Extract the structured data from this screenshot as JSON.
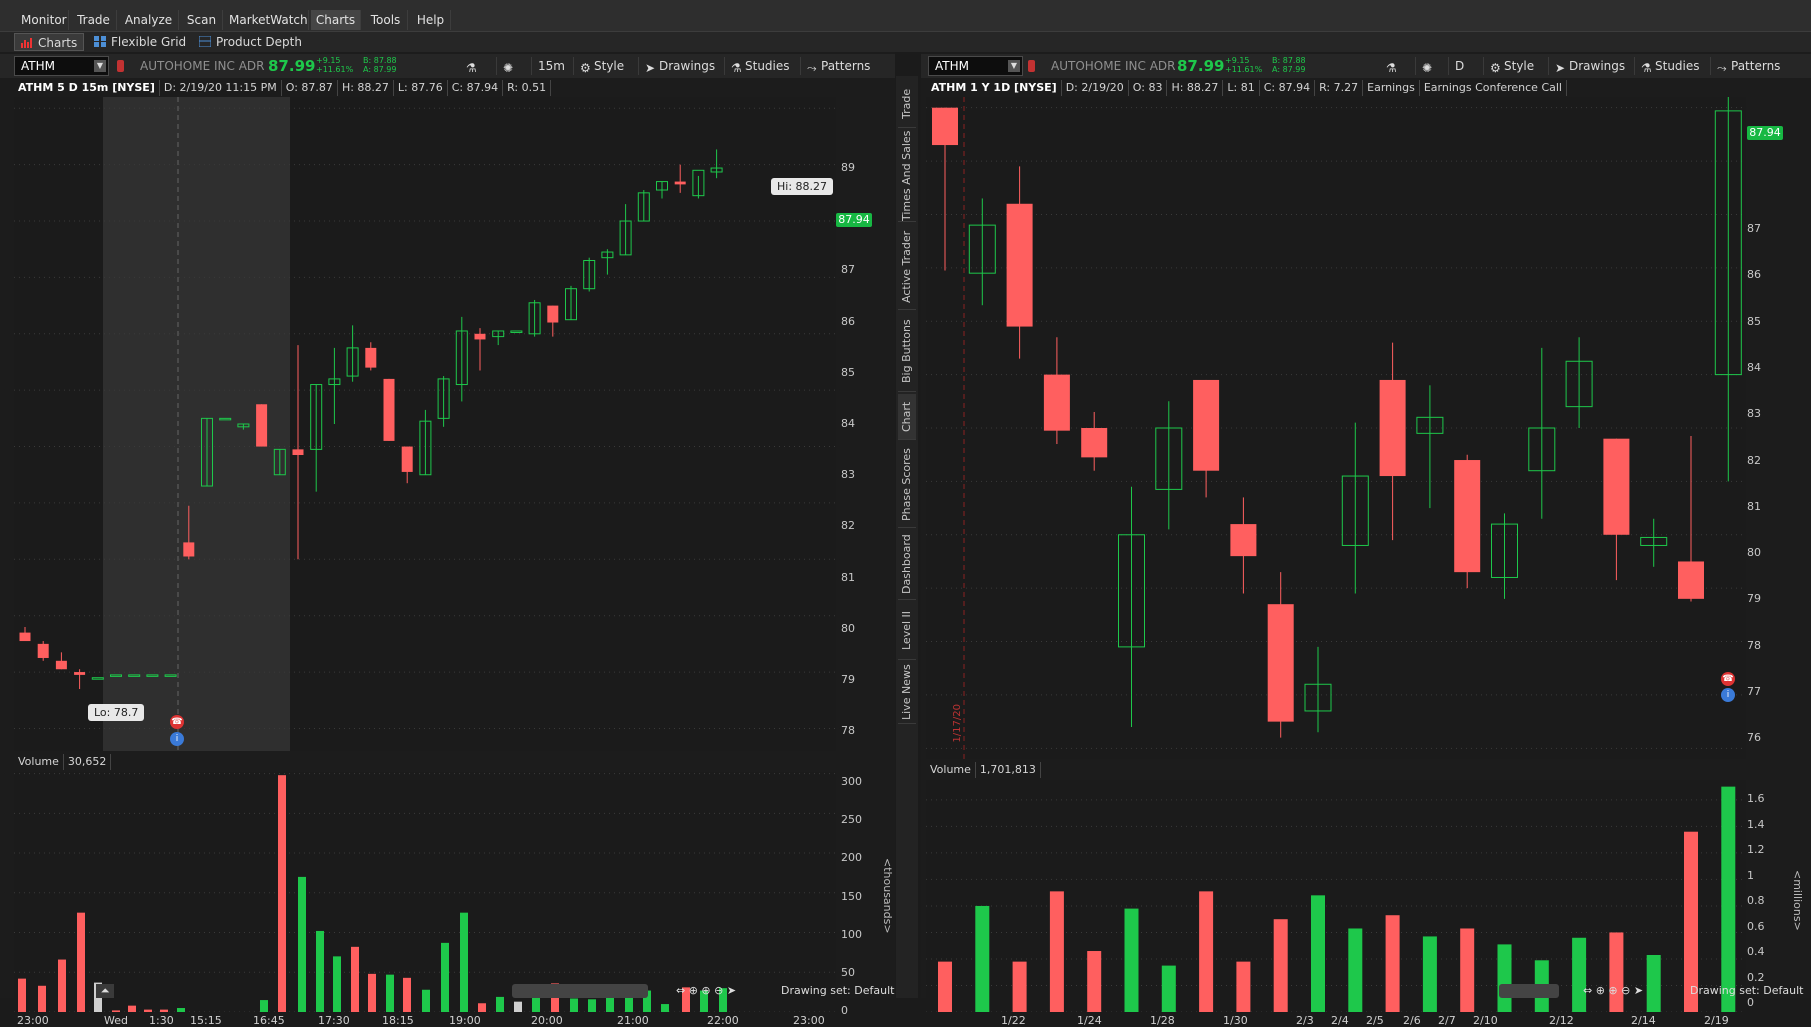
{
  "menu": [
    "Monitor",
    "Trade",
    "Analyze",
    "Scan",
    "MarketWatch",
    "Charts",
    "Tools",
    "Help"
  ],
  "submenu": {
    "charts": "Charts",
    "grid": "Flexible Grid",
    "depth": "Product Depth"
  },
  "left": {
    "symbol": "ATHM",
    "company": "AUTOHOME INC ADR",
    "last": "87.99",
    "chg": "+9.15",
    "chg_pct": "+11.61%",
    "bid": "B: 87.88",
    "ask": "A: 87.99",
    "timeframe": "15m",
    "style": "Style",
    "drawings": "Drawings",
    "studies": "Studies",
    "patterns": "Patterns",
    "info": [
      "ATHM 5 D 15m [NYSE]",
      "D: 2/19/20 11:15 PM",
      "O: 87.87",
      "H: 88.27",
      "L: 87.76",
      "C: 87.94",
      "R: 0.51"
    ],
    "hi_label": "Hi: 88.27",
    "lo_label": "Lo: 78.7",
    "price_tag": "87.94",
    "price_ticks": [
      "89",
      "88",
      "87",
      "86",
      "85",
      "84",
      "83",
      "82",
      "81",
      "80",
      "79",
      "78"
    ],
    "volume_label": "Volume",
    "volume_value": "30,652",
    "vol_ticks": [
      "300",
      "250",
      "200",
      "150",
      "100",
      "50",
      "0"
    ],
    "vol_unit": "<thousands>",
    "x_ticks": [
      "23:00",
      "Wed",
      "1:30",
      "15:15",
      "16:45",
      "17:30",
      "18:15",
      "19:00",
      "20:00",
      "21:00",
      "22:00",
      "23:00"
    ],
    "drawing_set": "Drawing set: Default"
  },
  "right": {
    "symbol": "ATHM",
    "company": "AUTOHOME INC ADR",
    "last": "87.99",
    "chg": "+9.15",
    "chg_pct": "+11.61%",
    "bid": "B: 87.88",
    "ask": "A: 87.99",
    "timeframe": "D",
    "style": "Style",
    "drawings": "Drawings",
    "studies": "Studies",
    "patterns": "Patterns",
    "info": [
      "ATHM 1 Y 1D [NYSE]",
      "D: 2/19/20",
      "O: 83",
      "H: 88.27",
      "L: 81",
      "C: 87.94",
      "R: 7.27",
      "Earnings",
      "Earnings Conference Call"
    ],
    "price_tag": "87.94",
    "marker": "1/17/20",
    "price_ticks": [
      "87",
      "86",
      "85",
      "84",
      "83",
      "82",
      "81",
      "80",
      "79",
      "78",
      "77",
      "76"
    ],
    "volume_label": "Volume",
    "volume_value": "1,701,813",
    "vol_ticks": [
      "1.6",
      "1.4",
      "1.2",
      "1",
      "0.8",
      "0.6",
      "0.4",
      "0.2",
      "0"
    ],
    "vol_unit": "<millions>",
    "x_ticks": [
      "1/22",
      "1/24",
      "1/28",
      "1/30",
      "2/3",
      "2/4",
      "2/5",
      "2/6",
      "2/7",
      "2/10",
      "2/12",
      "2/14",
      "2/19"
    ],
    "drawing_set": "Drawing set: Default"
  },
  "side_tabs": [
    "Trade",
    "Times And Sales",
    "Active Trader",
    "Big Buttons",
    "Chart",
    "Phase Scores",
    "Dashboard",
    "Level II",
    "Live News"
  ],
  "colors": {
    "up": "#1ec84b",
    "down": "#ff5f5f",
    "bg": "#1b1b1b",
    "grid": "#3a3a3a"
  },
  "chart_data": [
    {
      "type": "candlestick",
      "title": "ATHM 5 D 15m [NYSE]",
      "ylim": [
        77.6,
        89.2
      ],
      "candles": [
        {
          "o": 79.7,
          "h": 79.8,
          "l": 79.55,
          "c": 79.55
        },
        {
          "o": 79.5,
          "h": 79.55,
          "l": 79.2,
          "c": 79.25
        },
        {
          "o": 79.2,
          "h": 79.35,
          "l": 79.05,
          "c": 79.05
        },
        {
          "o": 79.0,
          "h": 79.05,
          "l": 78.7,
          "c": 78.95
        },
        {
          "o": 78.9,
          "h": 78.9,
          "l": 78.9,
          "c": 78.9
        },
        {
          "o": 78.95,
          "h": 78.95,
          "l": 78.95,
          "c": 78.95
        },
        {
          "o": 78.95,
          "h": 78.95,
          "l": 78.95,
          "c": 78.95
        },
        {
          "o": 78.95,
          "h": 78.95,
          "l": 78.95,
          "c": 78.95
        },
        {
          "o": 78.95,
          "h": 78.95,
          "l": 78.95,
          "c": 78.95
        },
        {
          "o": 81.3,
          "h": 81.95,
          "l": 81.0,
          "c": 81.05
        },
        {
          "o": 82.3,
          "h": 83.5,
          "l": 82.3,
          "c": 83.5
        },
        {
          "o": 83.5,
          "h": 83.5,
          "l": 83.5,
          "c": 83.5
        },
        {
          "o": 83.35,
          "h": 83.4,
          "l": 83.3,
          "c": 83.4
        },
        {
          "o": 83.75,
          "h": 83.75,
          "l": 83.0,
          "c": 83.0
        },
        {
          "o": 82.5,
          "h": 82.95,
          "l": 82.5,
          "c": 82.95
        },
        {
          "o": 82.95,
          "h": 84.8,
          "l": 81.0,
          "c": 82.85
        },
        {
          "o": 82.95,
          "h": 84.1,
          "l": 82.2,
          "c": 84.1
        },
        {
          "o": 84.1,
          "h": 84.75,
          "l": 83.4,
          "c": 84.2
        },
        {
          "o": 84.25,
          "h": 85.15,
          "l": 84.15,
          "c": 84.75
        },
        {
          "o": 84.75,
          "h": 84.85,
          "l": 84.35,
          "c": 84.4
        },
        {
          "o": 84.2,
          "h": 84.2,
          "l": 83.1,
          "c": 83.1
        },
        {
          "o": 83.0,
          "h": 83.0,
          "l": 82.35,
          "c": 82.55
        },
        {
          "o": 82.5,
          "h": 83.65,
          "l": 82.5,
          "c": 83.45
        },
        {
          "o": 83.5,
          "h": 84.25,
          "l": 83.35,
          "c": 84.2
        },
        {
          "o": 84.1,
          "h": 85.3,
          "l": 83.8,
          "c": 85.05
        },
        {
          "o": 85.0,
          "h": 85.1,
          "l": 84.35,
          "c": 84.9
        },
        {
          "o": 84.95,
          "h": 85.05,
          "l": 84.8,
          "c": 85.05
        },
        {
          "o": 85.05,
          "h": 85.05,
          "l": 85.05,
          "c": 85.05
        },
        {
          "o": 85.0,
          "h": 85.6,
          "l": 84.95,
          "c": 85.55
        },
        {
          "o": 85.5,
          "h": 85.5,
          "l": 84.95,
          "c": 85.2
        },
        {
          "o": 85.25,
          "h": 85.85,
          "l": 85.25,
          "c": 85.8
        },
        {
          "o": 85.8,
          "h": 86.35,
          "l": 85.75,
          "c": 86.3
        },
        {
          "o": 86.35,
          "h": 86.5,
          "l": 86.05,
          "c": 86.45
        },
        {
          "o": 86.4,
          "h": 87.3,
          "l": 86.4,
          "c": 87.0
        },
        {
          "o": 87.0,
          "h": 87.55,
          "l": 87.0,
          "c": 87.5
        },
        {
          "o": 87.55,
          "h": 87.7,
          "l": 87.4,
          "c": 87.7
        },
        {
          "o": 87.7,
          "h": 88.0,
          "l": 87.5,
          "c": 87.65
        },
        {
          "o": 87.45,
          "h": 87.8,
          "l": 87.4,
          "c": 87.9
        },
        {
          "o": 87.87,
          "h": 88.27,
          "l": 87.76,
          "c": 87.94
        }
      ],
      "volume": [
        {
          "v": 42,
          "d": "down"
        },
        {
          "v": 33,
          "d": "down"
        },
        {
          "v": 66,
          "d": "down"
        },
        {
          "v": 125,
          "d": "down"
        },
        {
          "v": 37,
          "d": "flat"
        },
        {
          "v": 2,
          "d": "down"
        },
        {
          "v": 8,
          "d": "down"
        },
        {
          "v": 3,
          "d": "down"
        },
        {
          "v": 3,
          "d": "down"
        },
        {
          "v": 5,
          "d": "up"
        },
        {
          "v": 15,
          "d": "up"
        },
        {
          "v": 298,
          "d": "down"
        },
        {
          "v": 170,
          "d": "up"
        },
        {
          "v": 102,
          "d": "up"
        },
        {
          "v": 70,
          "d": "up"
        },
        {
          "v": 82,
          "d": "down"
        },
        {
          "v": 48,
          "d": "down"
        },
        {
          "v": 47,
          "d": "up"
        },
        {
          "v": 43,
          "d": "down"
        },
        {
          "v": 28,
          "d": "up"
        },
        {
          "v": 87,
          "d": "up"
        },
        {
          "v": 125,
          "d": "up"
        },
        {
          "v": 11,
          "d": "down"
        },
        {
          "v": 19,
          "d": "up"
        },
        {
          "v": 13,
          "d": "flat"
        },
        {
          "v": 23,
          "d": "up"
        },
        {
          "v": 36,
          "d": "down"
        },
        {
          "v": 17,
          "d": "up"
        },
        {
          "v": 16,
          "d": "up"
        },
        {
          "v": 24,
          "d": "up"
        },
        {
          "v": 29,
          "d": "up"
        },
        {
          "v": 27,
          "d": "up"
        },
        {
          "v": 10,
          "d": "up"
        },
        {
          "v": 31,
          "d": "down"
        },
        {
          "v": 27,
          "d": "up"
        },
        {
          "v": 30,
          "d": "up"
        }
      ]
    },
    {
      "type": "candlestick",
      "title": "ATHM 1 Y 1D [NYSE]",
      "ylim": [
        75.8,
        88.2
      ],
      "candles": [
        {
          "o": 88.0,
          "h": 88.0,
          "l": 84.95,
          "c": 87.3
        },
        {
          "o": 84.9,
          "h": 86.3,
          "l": 84.3,
          "c": 85.8
        },
        {
          "o": 86.2,
          "h": 86.9,
          "l": 83.3,
          "c": 83.9
        },
        {
          "o": 83.0,
          "h": 83.7,
          "l": 81.7,
          "c": 81.95
        },
        {
          "o": 82.0,
          "h": 82.3,
          "l": 81.2,
          "c": 81.45
        },
        {
          "o": 77.9,
          "h": 80.9,
          "l": 76.4,
          "c": 80.0
        },
        {
          "o": 80.85,
          "h": 82.5,
          "l": 80.1,
          "c": 82.0
        },
        {
          "o": 82.9,
          "h": 82.9,
          "l": 80.7,
          "c": 81.2
        },
        {
          "o": 80.2,
          "h": 80.7,
          "l": 78.9,
          "c": 79.6
        },
        {
          "o": 78.7,
          "h": 79.3,
          "l": 76.2,
          "c": 76.5
        },
        {
          "o": 76.7,
          "h": 77.9,
          "l": 76.3,
          "c": 77.2
        },
        {
          "o": 79.8,
          "h": 82.1,
          "l": 78.9,
          "c": 81.1
        },
        {
          "o": 82.9,
          "h": 83.6,
          "l": 79.9,
          "c": 81.1
        },
        {
          "o": 81.9,
          "h": 82.8,
          "l": 80.5,
          "c": 82.2
        },
        {
          "o": 81.4,
          "h": 81.5,
          "l": 79.0,
          "c": 79.3
        },
        {
          "o": 79.2,
          "h": 80.4,
          "l": 78.8,
          "c": 80.2
        },
        {
          "o": 81.2,
          "h": 83.5,
          "l": 80.3,
          "c": 82.0
        },
        {
          "o": 82.4,
          "h": 83.7,
          "l": 82.0,
          "c": 83.25
        },
        {
          "o": 81.8,
          "h": 81.8,
          "l": 79.15,
          "c": 80.0
        },
        {
          "o": 79.8,
          "h": 80.3,
          "l": 79.4,
          "c": 79.95
        },
        {
          "o": 79.5,
          "h": 81.85,
          "l": 78.75,
          "c": 78.8
        },
        {
          "o": 83.0,
          "h": 88.27,
          "l": 81.0,
          "c": 87.94
        }
      ],
      "volume": [
        {
          "v": 0.38,
          "d": "down"
        },
        {
          "v": 0.8,
          "d": "up"
        },
        {
          "v": 0.38,
          "d": "down"
        },
        {
          "v": 0.91,
          "d": "down"
        },
        {
          "v": 0.46,
          "d": "down"
        },
        {
          "v": 0.78,
          "d": "up"
        },
        {
          "v": 0.35,
          "d": "up"
        },
        {
          "v": 0.91,
          "d": "down"
        },
        {
          "v": 0.38,
          "d": "down"
        },
        {
          "v": 0.7,
          "d": "down"
        },
        {
          "v": 0.88,
          "d": "up"
        },
        {
          "v": 0.63,
          "d": "up"
        },
        {
          "v": 0.73,
          "d": "down"
        },
        {
          "v": 0.57,
          "d": "up"
        },
        {
          "v": 0.63,
          "d": "down"
        },
        {
          "v": 0.51,
          "d": "up"
        },
        {
          "v": 0.39,
          "d": "up"
        },
        {
          "v": 0.56,
          "d": "up"
        },
        {
          "v": 0.6,
          "d": "down"
        },
        {
          "v": 0.43,
          "d": "up"
        },
        {
          "v": 1.36,
          "d": "down"
        },
        {
          "v": 1.7,
          "d": "up"
        }
      ]
    }
  ]
}
